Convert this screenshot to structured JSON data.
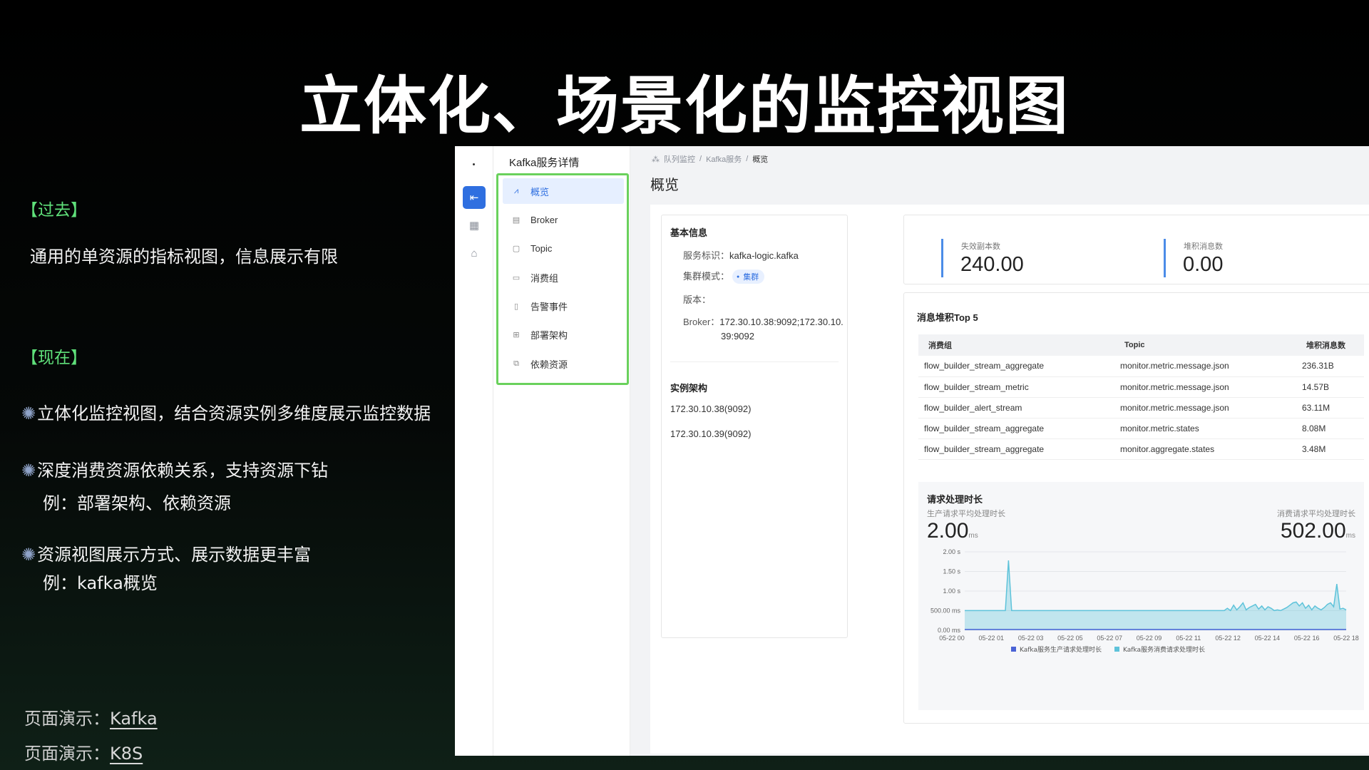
{
  "slide": {
    "title": "立体化、场景化的监控视图",
    "past_label": "【过去】",
    "past_text": "通用的单资源的指标视图，信息展示有限",
    "now_label": "【现在】",
    "bullets": [
      {
        "text": "立体化监控视图，结合资源实例多维度展示监控数据",
        "sub": ""
      },
      {
        "text": "深度消费资源依赖关系，支持资源下钻",
        "sub": "例：部署架构、依赖资源"
      },
      {
        "text": "资源视图展示方式、展示数据更丰富",
        "sub": "例：kafka概览"
      }
    ],
    "demos": [
      {
        "prefix": "页面演示：",
        "link": "Kafka"
      },
      {
        "prefix": "页面演示：",
        "link": "K8S"
      }
    ]
  },
  "app": {
    "nav_title": "Kafka服务详情",
    "nav_items": [
      {
        "label": "概览",
        "icon": "line-chart-icon",
        "active": true
      },
      {
        "label": "Broker",
        "icon": "server-icon"
      },
      {
        "label": "Topic",
        "icon": "topic-icon"
      },
      {
        "label": "消费组",
        "icon": "message-icon"
      },
      {
        "label": "告警事件",
        "icon": "alert-icon"
      },
      {
        "label": "部署架构",
        "icon": "hierarchy-icon"
      },
      {
        "label": "依赖资源",
        "icon": "link-icon"
      }
    ],
    "breadcrumb": [
      "队列监控",
      "Kafka服务",
      "概览"
    ],
    "page_title": "概览",
    "basic": {
      "title": "基本信息",
      "service_id_label": "服务标识：",
      "service_id": "kafka-logic.kafka",
      "cluster_mode_label": "集群模式：",
      "cluster_mode": "集群",
      "version_label": "版本：",
      "version": "",
      "broker_label": "Broker：",
      "broker_line1": "172.30.10.38:9092;172.30.10.",
      "broker_line2": "39:9092"
    },
    "instances": {
      "title": "实例架构",
      "items": [
        "172.30.10.38(9092)",
        "172.30.10.39(9092)"
      ]
    },
    "stats": [
      {
        "label": "失效副本数",
        "value": "240.00"
      },
      {
        "label": "堆积消息数",
        "value": "0.00"
      }
    ],
    "top5": {
      "title": "消息堆积Top 5",
      "headers": [
        "消费组",
        "Topic",
        "堆积消息数"
      ],
      "rows": [
        [
          "flow_builder_stream_aggregate",
          "monitor.metric.message.json",
          "236.31B"
        ],
        [
          "flow_builder_stream_metric",
          "monitor.metric.message.json",
          "14.57B"
        ],
        [
          "flow_builder_alert_stream",
          "monitor.metric.message.json",
          "63.11M"
        ],
        [
          "flow_builder_stream_aggregate",
          "monitor.metric.states",
          "8.08M"
        ],
        [
          "flow_builder_stream_aggregate",
          "monitor.aggregate.states",
          "3.48M"
        ]
      ]
    },
    "latency": {
      "title": "请求处理时长",
      "produce_label": "生产请求平均处理时长",
      "produce_value": "2.00",
      "consume_label": "消费请求平均处理时长",
      "consume_value": "502.00",
      "unit": "ms"
    }
  },
  "chart_data": {
    "type": "area",
    "title": "请求处理时长",
    "y_unit": "ms",
    "ylim": [
      0,
      2000
    ],
    "yticks": [
      {
        "value": 2000,
        "label": "2.00 s"
      },
      {
        "value": 1500,
        "label": "1.50 s"
      },
      {
        "value": 1000,
        "label": "1.00 s"
      },
      {
        "value": 500,
        "label": "500.00 ms"
      },
      {
        "value": 0,
        "label": "0.00 ms"
      }
    ],
    "categories": [
      "05-22 00",
      "05-22 01",
      "05-22 03",
      "05-22 05",
      "05-22 07",
      "05-22 09",
      "05-22 11",
      "05-22 12",
      "05-22 14",
      "05-22 16",
      "05-22 18"
    ],
    "legend_position": "bottom",
    "series": [
      {
        "name": "Kafka服务生产请求处理时长",
        "color": "#4a63d6",
        "values": [
          2,
          2,
          2,
          2,
          2,
          2,
          2,
          2,
          2,
          2,
          2,
          2,
          2,
          2,
          2,
          2,
          2,
          2,
          2,
          2,
          2,
          2,
          2,
          2,
          2,
          2,
          2,
          2,
          2,
          2,
          2,
          2,
          2,
          2,
          2,
          2,
          2,
          2,
          2,
          2,
          2,
          2,
          2,
          2,
          2,
          2,
          2,
          2,
          2,
          2,
          2
        ]
      },
      {
        "name": "Kafka服务消费请求处理时长",
        "color": "#5ec3da",
        "values": [
          502,
          502,
          502,
          502,
          502,
          502,
          502,
          502,
          502,
          502,
          502,
          502,
          502,
          502,
          1780,
          502,
          502,
          502,
          502,
          502,
          502,
          502,
          502,
          502,
          502,
          502,
          502,
          502,
          502,
          502,
          502,
          502,
          502,
          502,
          502,
          502,
          502,
          502,
          502,
          502,
          502,
          502,
          502,
          502,
          502,
          502,
          502,
          502,
          502,
          502,
          502,
          502,
          502,
          502,
          502,
          502,
          502,
          502,
          502,
          502,
          502,
          502,
          502,
          502,
          502,
          502,
          502,
          502,
          502,
          502,
          502,
          502,
          502,
          502,
          502,
          502,
          502,
          502,
          502,
          502,
          502,
          502,
          502,
          502,
          560,
          502,
          640,
          520,
          600,
          700,
          520,
          580,
          620,
          660,
          540,
          620,
          520,
          600,
          560,
          502,
          520,
          502,
          540,
          580,
          640,
          700,
          720,
          620,
          700,
          560,
          640,
          520,
          620,
          560,
          520,
          580,
          660,
          700,
          600,
          1180,
          540,
          560,
          520
        ]
      }
    ]
  }
}
